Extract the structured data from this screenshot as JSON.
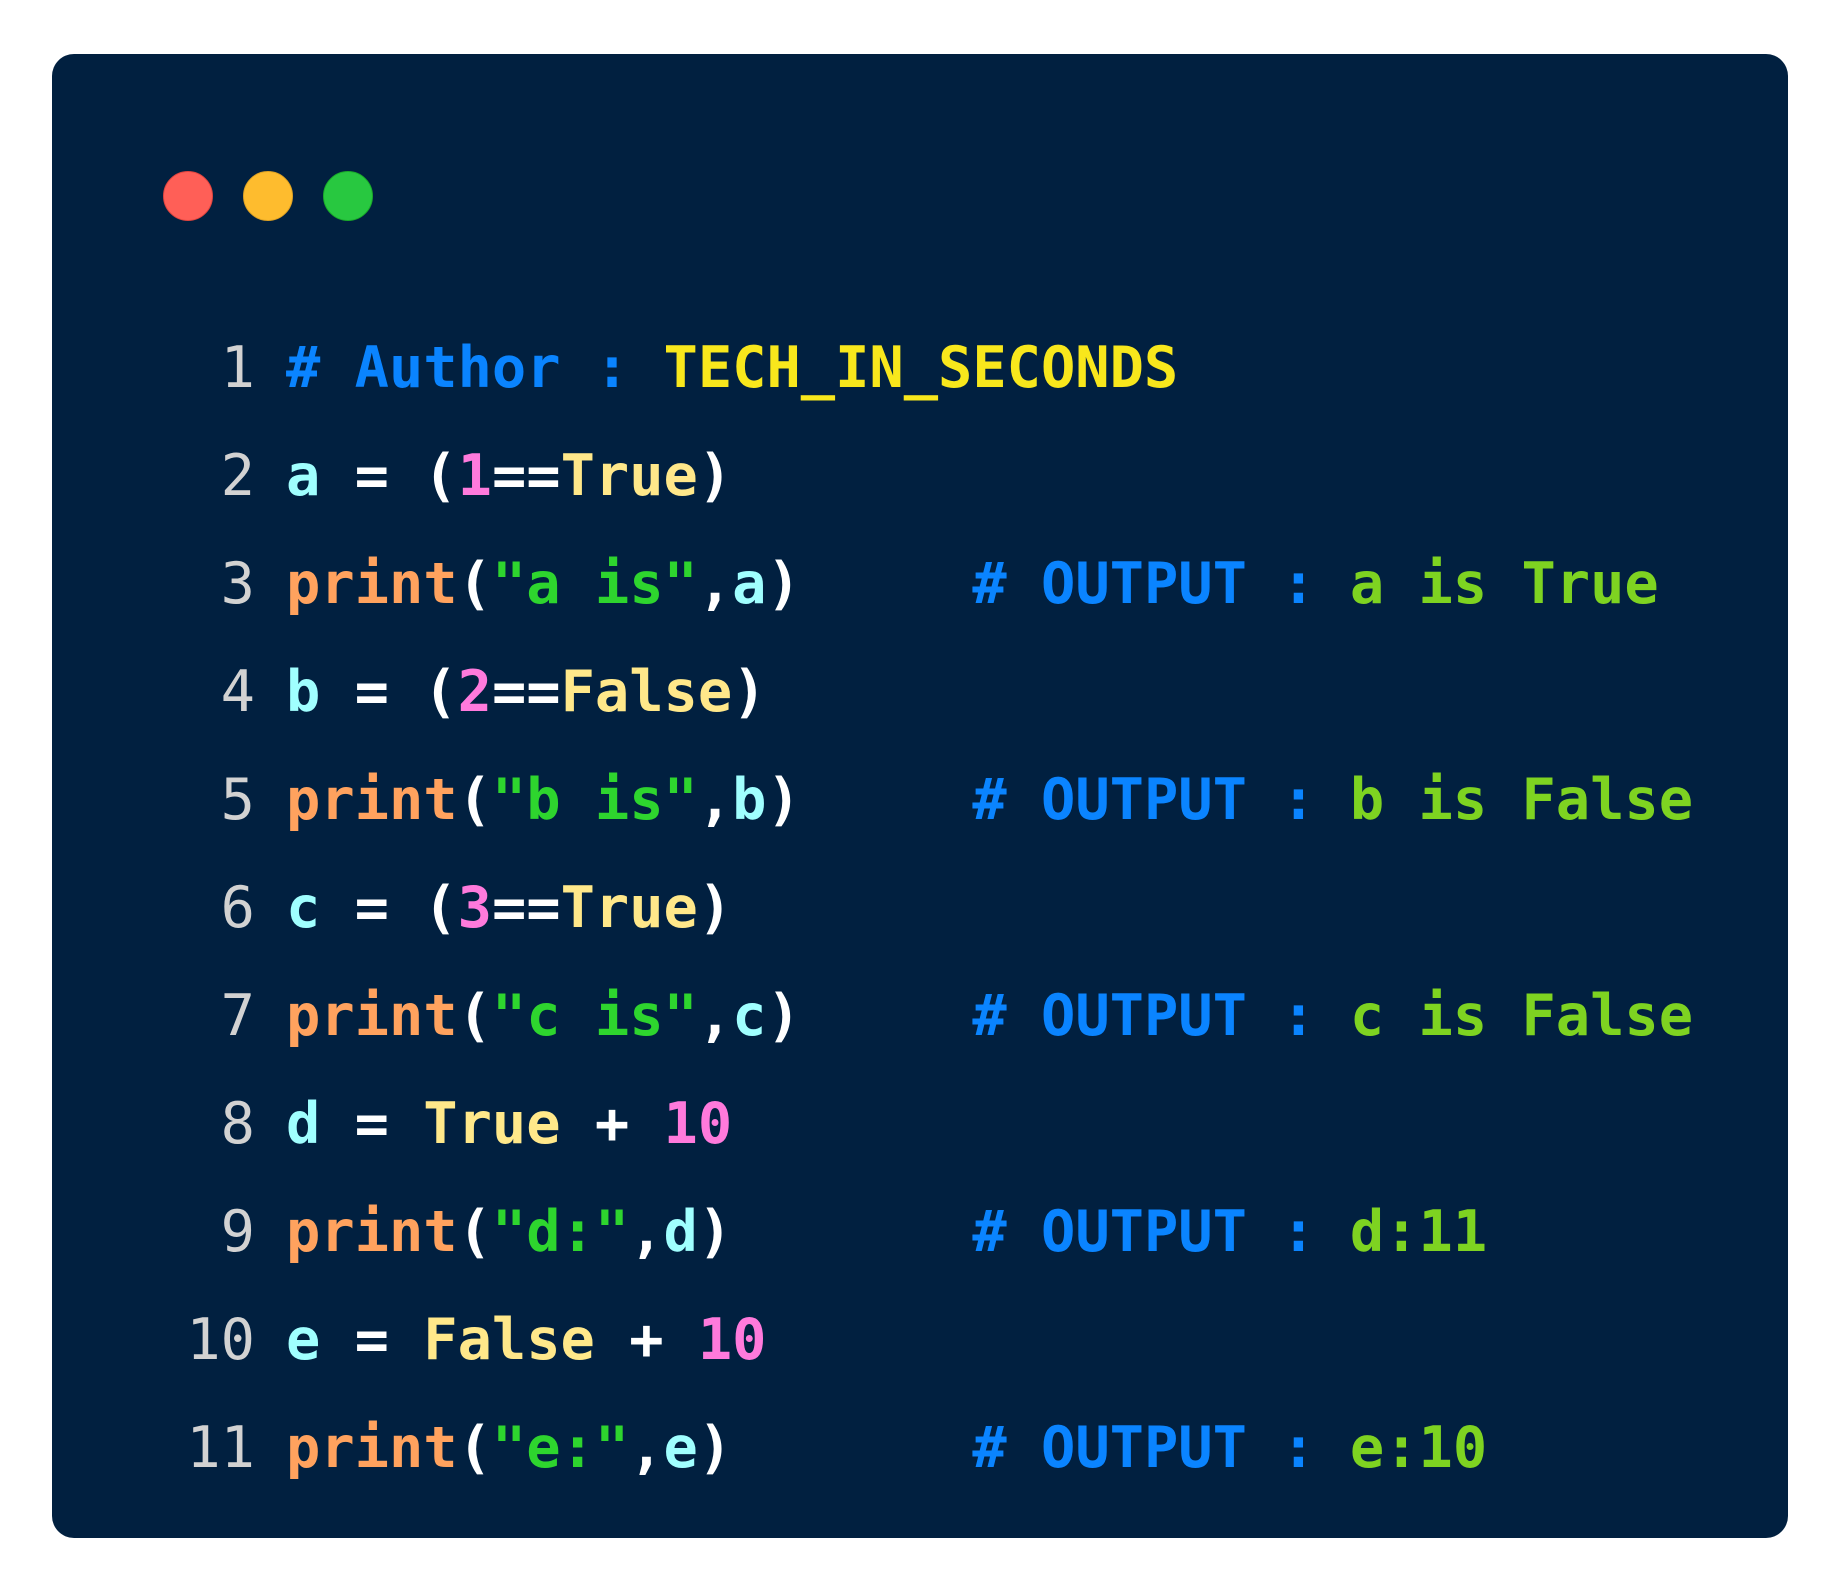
{
  "window": {
    "controls": [
      "close",
      "minimize",
      "maximize"
    ],
    "colors": {
      "close": "#FF5F57",
      "minimize": "#FEBC2E",
      "maximize": "#28C840",
      "background": "#012040"
    }
  },
  "code": {
    "lines": [
      {
        "number": "1",
        "tokens": [
          {
            "t": "comment",
            "text": "# Author : "
          },
          {
            "t": "author",
            "text": "TECH_IN_SECONDS"
          }
        ]
      },
      {
        "number": "2",
        "tokens": [
          {
            "t": "ident",
            "text": "a"
          },
          {
            "t": "op",
            "text": " = ("
          },
          {
            "t": "num",
            "text": "1"
          },
          {
            "t": "op",
            "text": "=="
          },
          {
            "t": "bool",
            "text": "True"
          },
          {
            "t": "op",
            "text": ")"
          }
        ]
      },
      {
        "number": "3",
        "tokens": [
          {
            "t": "func",
            "text": "print"
          },
          {
            "t": "op",
            "text": "("
          },
          {
            "t": "str",
            "text": "\"a is\""
          },
          {
            "t": "op",
            "text": ","
          },
          {
            "t": "ident",
            "text": "a"
          },
          {
            "t": "op",
            "text": ")     "
          },
          {
            "t": "comment",
            "text": "# OUTPUT : "
          },
          {
            "t": "out",
            "text": "a is True"
          }
        ]
      },
      {
        "number": "4",
        "tokens": [
          {
            "t": "ident",
            "text": "b"
          },
          {
            "t": "op",
            "text": " = ("
          },
          {
            "t": "num",
            "text": "2"
          },
          {
            "t": "op",
            "text": "=="
          },
          {
            "t": "bool",
            "text": "False"
          },
          {
            "t": "op",
            "text": ")"
          }
        ]
      },
      {
        "number": "5",
        "tokens": [
          {
            "t": "func",
            "text": "print"
          },
          {
            "t": "op",
            "text": "("
          },
          {
            "t": "str",
            "text": "\"b is\""
          },
          {
            "t": "op",
            "text": ","
          },
          {
            "t": "ident",
            "text": "b"
          },
          {
            "t": "op",
            "text": ")     "
          },
          {
            "t": "comment",
            "text": "# OUTPUT : "
          },
          {
            "t": "out",
            "text": "b is False"
          }
        ]
      },
      {
        "number": "6",
        "tokens": [
          {
            "t": "ident",
            "text": "c"
          },
          {
            "t": "op",
            "text": " = ("
          },
          {
            "t": "num",
            "text": "3"
          },
          {
            "t": "op",
            "text": "=="
          },
          {
            "t": "bool",
            "text": "True"
          },
          {
            "t": "op",
            "text": ")"
          }
        ]
      },
      {
        "number": "7",
        "tokens": [
          {
            "t": "func",
            "text": "print"
          },
          {
            "t": "op",
            "text": "("
          },
          {
            "t": "str",
            "text": "\"c is\""
          },
          {
            "t": "op",
            "text": ","
          },
          {
            "t": "ident",
            "text": "c"
          },
          {
            "t": "op",
            "text": ")     "
          },
          {
            "t": "comment",
            "text": "# OUTPUT : "
          },
          {
            "t": "out",
            "text": "c is False"
          }
        ]
      },
      {
        "number": "8",
        "tokens": [
          {
            "t": "ident",
            "text": "d"
          },
          {
            "t": "op",
            "text": " = "
          },
          {
            "t": "bool",
            "text": "True"
          },
          {
            "t": "op",
            "text": " + "
          },
          {
            "t": "num",
            "text": "10"
          }
        ]
      },
      {
        "number": "9",
        "tokens": [
          {
            "t": "func",
            "text": "print"
          },
          {
            "t": "op",
            "text": "("
          },
          {
            "t": "str",
            "text": "\"d:\""
          },
          {
            "t": "op",
            "text": ","
          },
          {
            "t": "ident",
            "text": "d"
          },
          {
            "t": "op",
            "text": ")       "
          },
          {
            "t": "comment",
            "text": "# OUTPUT : "
          },
          {
            "t": "out",
            "text": "d:11"
          }
        ]
      },
      {
        "number": "10",
        "tokens": [
          {
            "t": "ident",
            "text": "e"
          },
          {
            "t": "op",
            "text": " = "
          },
          {
            "t": "bool",
            "text": "False"
          },
          {
            "t": "op",
            "text": " + "
          },
          {
            "t": "num",
            "text": "10"
          }
        ]
      },
      {
        "number": "11",
        "tokens": [
          {
            "t": "func",
            "text": "print"
          },
          {
            "t": "op",
            "text": "("
          },
          {
            "t": "str",
            "text": "\"e:\""
          },
          {
            "t": "op",
            "text": ","
          },
          {
            "t": "ident",
            "text": "e"
          },
          {
            "t": "op",
            "text": ")       "
          },
          {
            "t": "comment",
            "text": "# OUTPUT : "
          },
          {
            "t": "out",
            "text": "e:10"
          }
        ]
      }
    ]
  }
}
